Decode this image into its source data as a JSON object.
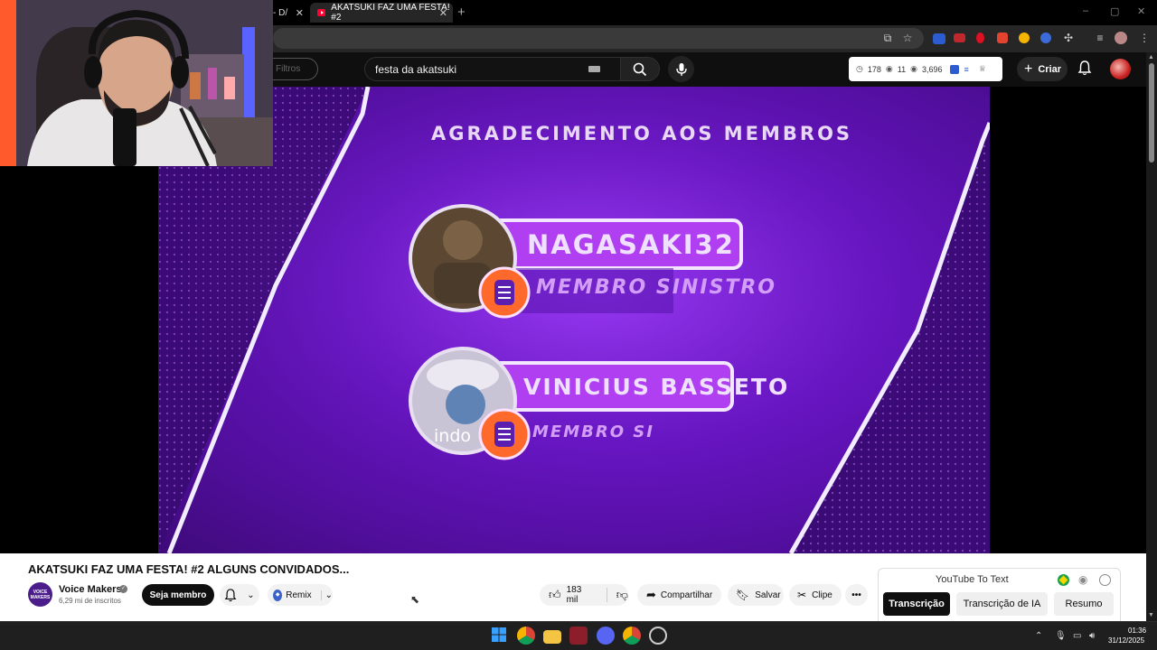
{
  "browser": {
    "tabs": [
      {
        "label": "- D/",
        "active": false
      },
      {
        "label": "AKATSUKI FAZ UMA FESTA! #2",
        "active": true
      }
    ],
    "new_tab_symbol": "+",
    "window_controls": [
      "–",
      "▢",
      "✕"
    ]
  },
  "masthead": {
    "filter_label": "Filtros",
    "search_value": "festa da akatsuki",
    "stats": {
      "watch_time": "178",
      "views_a": "11",
      "views_b": "3,696"
    },
    "create_label": "Criar"
  },
  "video": {
    "banner_title": "AGRADECIMENTO AOS MEMBROS",
    "members": [
      {
        "name": "NAGASAKI32",
        "role": "MEMBRO SINISTRO"
      },
      {
        "name": "VINICIUS BASSETO",
        "role": "MEMBRO SI"
      }
    ],
    "caption_fragment": "indo"
  },
  "details": {
    "title": "AKATSUKI FAZ UMA FESTA! #2 ALGUNS CONVIDADOS...",
    "channel_name": "Voice Makers",
    "channel_avatar_text": "VOICE MAKERS",
    "subscribers": "6,29 mi de inscritos",
    "join_label": "Seja membro",
    "remix_label": "Remix",
    "like_count": "183 mil",
    "share_label": "Compartilhar",
    "save_label": "Salvar",
    "clip_label": "Clipe",
    "more_label": "•••"
  },
  "yt_to_text": {
    "title": "YouTube To Text",
    "tabs": [
      "Transcrição",
      "Transcrição de IA",
      "Resumo"
    ]
  },
  "taskbar": {
    "time": "01:36",
    "date": "31/12/2025"
  },
  "colors": {
    "accent_red": "#ff0033",
    "video_purple": "#6a14c9",
    "neon_pink": "#ff6bd9"
  }
}
